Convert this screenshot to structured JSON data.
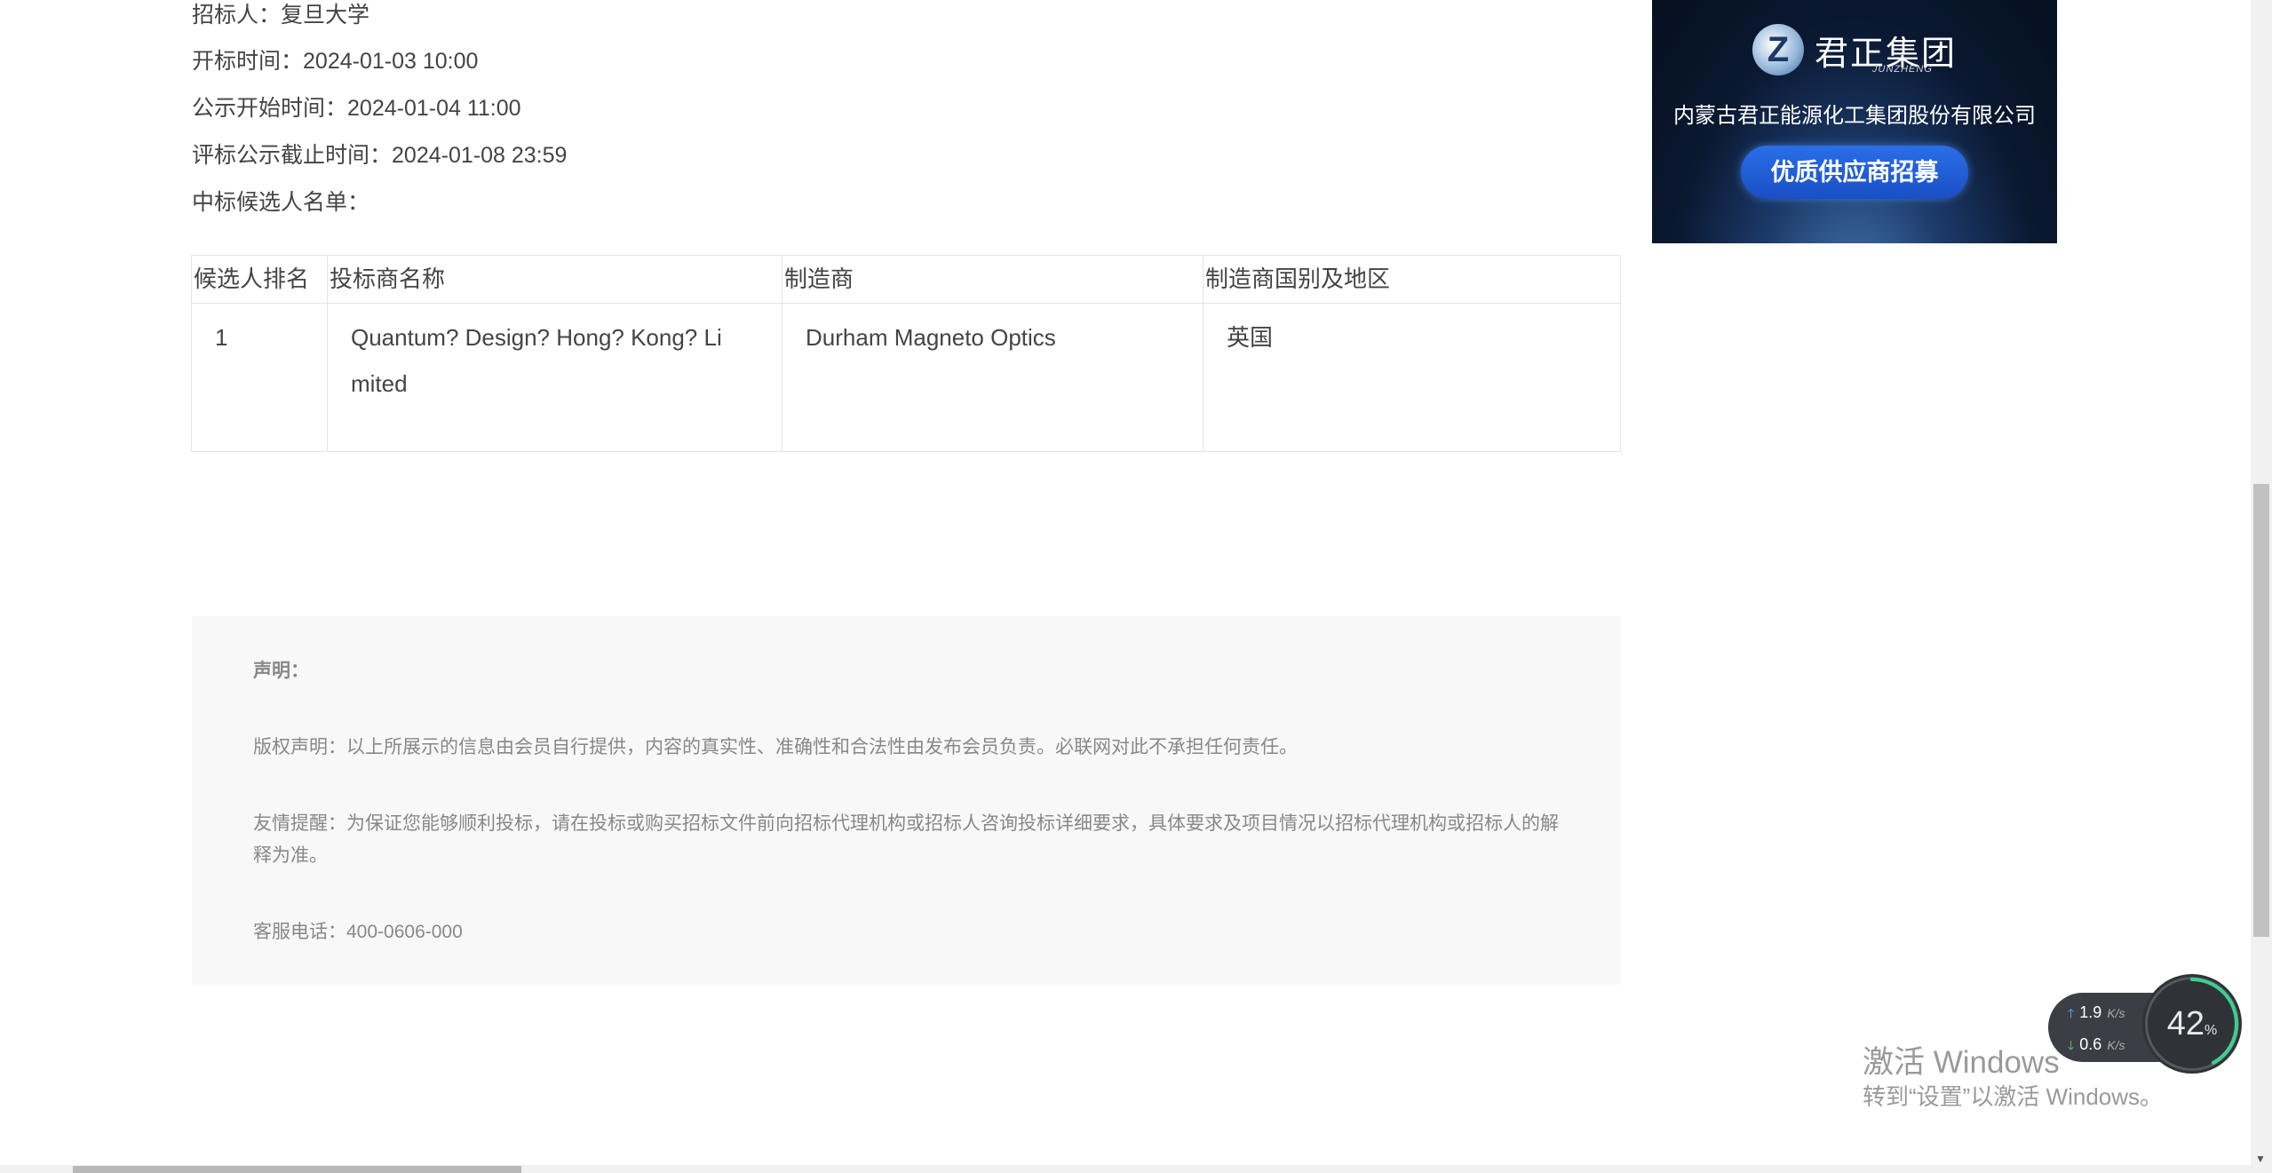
{
  "info": {
    "tenderer": "招标人：复旦大学",
    "opening_time_label": "开标时间：",
    "opening_time": "2024-01-03 10:00",
    "publicity_start_label": "公示开始时间：",
    "publicity_start": "2024-01-04 11:00",
    "publicity_end_label": "评标公示截止时间：",
    "publicity_end": "2024-01-08 23:59",
    "candidate_list_label": "中标候选人名单："
  },
  "table": {
    "headers": [
      "候选人排名",
      "投标商名称",
      "制造商",
      "制造商国别及地区"
    ],
    "rows": [
      {
        "rank": "1",
        "bidder_line1": "Quantum? Design? Hong? Kong? Li",
        "bidder_line2": "mited",
        "manufacturer": "Durham Magneto Optics",
        "country": "英国"
      }
    ]
  },
  "notice": {
    "title": "声明：",
    "copyright": "版权声明：以上所展示的信息由会员自行提供，内容的真实性、准确性和合法性由发布会员负责。必联网对此不承担任何责任。",
    "reminder": "友情提醒：为保证您能够顺利投标，请在投标或购买招标文件前向招标代理机构或招标人咨询投标详细要求，具体要求及项目情况以招标代理机构或招标人的解释为准。",
    "phone": "客服电话：400-0606-000"
  },
  "ad": {
    "brand": "君正集团",
    "brand_sub": "JUNZHENG",
    "company": "内蒙古君正能源化工集团股份有限公司",
    "cta": "优质供应商招募"
  },
  "net_widget": {
    "upload": "1.9",
    "download": "0.6",
    "unit": "K/s",
    "percent": "42",
    "percent_sign": "%",
    "percent_value": 0.42
  },
  "watermark": {
    "title": "激活 Windows",
    "subtitle": "转到“设置”以激活 Windows。"
  }
}
